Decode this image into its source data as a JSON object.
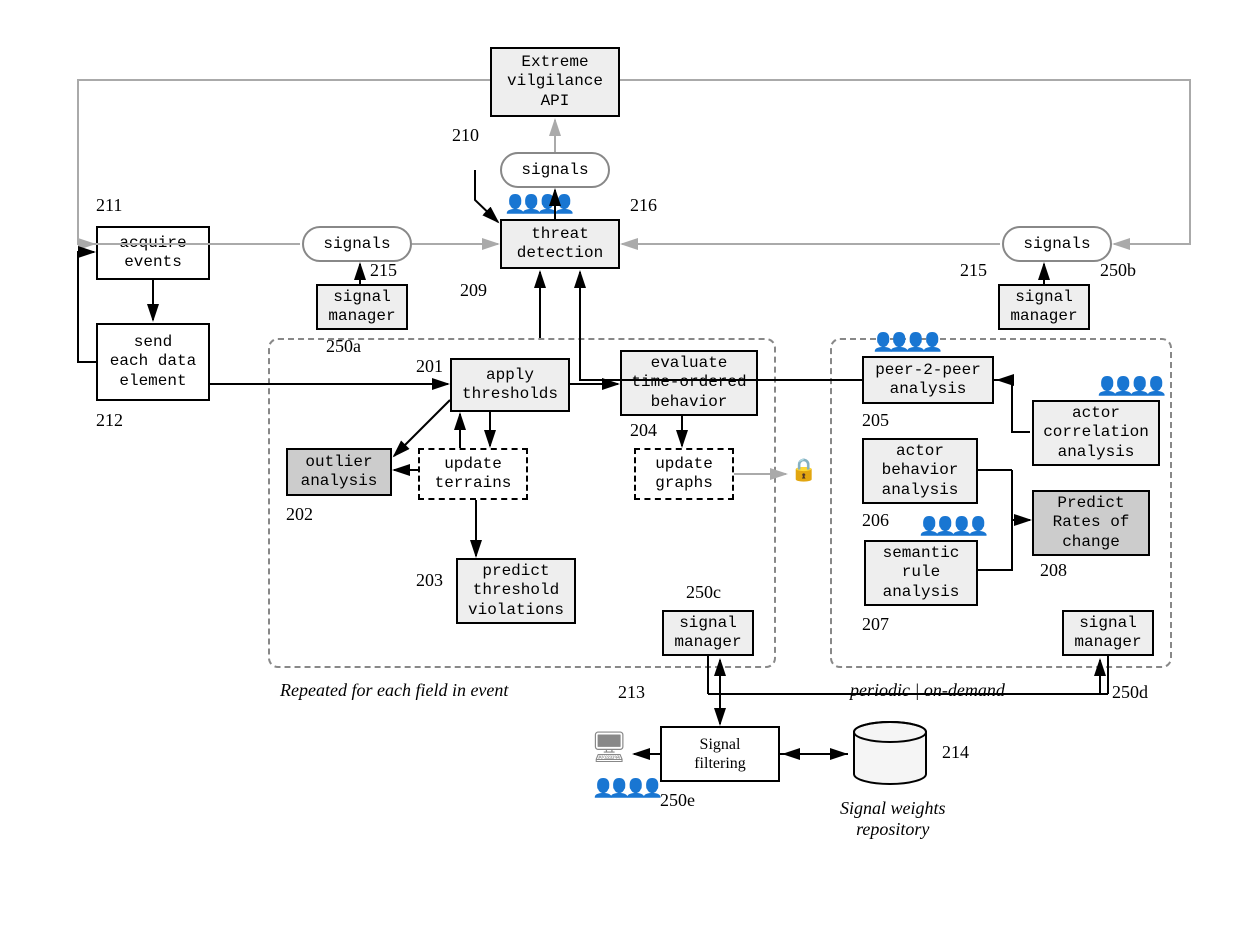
{
  "boxes": {
    "extreme_api": "Extreme\nvilgilance\nAPI",
    "threat_detection": "threat\ndetection",
    "acquire_events": "acquire\nevents",
    "send_each": "send\neach data\nelement",
    "signal_manager": "signal\nmanager",
    "apply_thresholds": "apply\nthresholds",
    "evaluate_time": "evaluate\ntime-ordered\nbehavior",
    "outlier_analysis": "outlier\nanalysis",
    "update_terrains": "update\nterrains",
    "update_graphs": "update\ngraphs",
    "predict_threshold": "predict\nthreshold\nviolations",
    "peer2peer": "peer-2-peer\nanalysis",
    "actor_corr": "actor\ncorrelation\nanalysis",
    "actor_behavior": "actor\nbehavior\nanalysis",
    "predict_rates": "Predict\nRates of\nchange",
    "semantic_rule": "semantic\nrule\nanalysis",
    "signal_filtering": "Signal\nfiltering"
  },
  "ovals": {
    "signals": "signals"
  },
  "labels": {
    "l210": "210",
    "l211": "211",
    "l212": "212",
    "l215a": "215",
    "l215b": "215",
    "l216": "216",
    "l209": "209",
    "l250a": "250a",
    "l250b": "250b",
    "l250c": "250c",
    "l250d": "250d",
    "l250e": "250e",
    "l201": "201",
    "l202": "202",
    "l203": "203",
    "l204": "204",
    "l205": "205",
    "l206": "206",
    "l207": "207",
    "l208": "208",
    "l213": "213",
    "l214": "214"
  },
  "captions": {
    "repeated": "Repeated for each field in event",
    "periodic": "periodic | on-demand",
    "weights_repo": "Signal weights\nrepository"
  }
}
